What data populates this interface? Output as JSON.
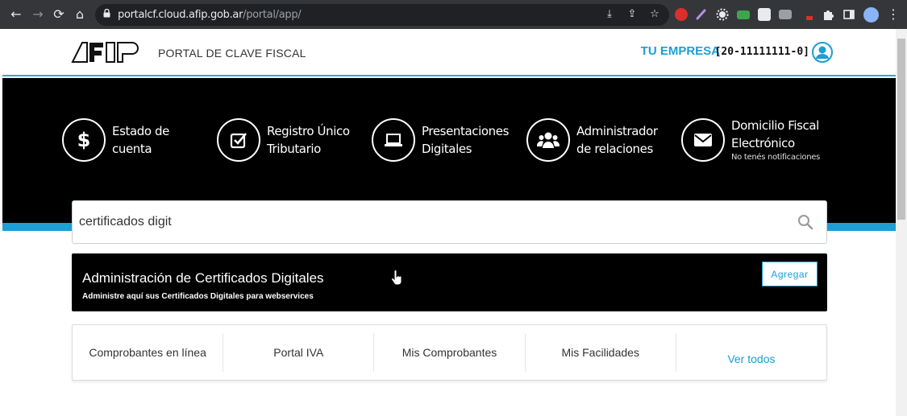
{
  "browser": {
    "url_host": "portalcf.cloud.afip.gob.ar",
    "url_path": "/portal/app/"
  },
  "header": {
    "logo_text": "AFIP",
    "portal_title": "PORTAL DE CLAVE FISCAL",
    "company_name": "TU EMPRESA",
    "cuit": "[20-11111111-0]"
  },
  "shortcuts": [
    {
      "line1": "Estado de",
      "line2": "cuenta",
      "icon": "dollar-icon"
    },
    {
      "line1": "Registro Único",
      "line2": "Tributario",
      "icon": "checkbox-icon"
    },
    {
      "line1": "Presentaciones",
      "line2": "Digitales",
      "icon": "laptop-icon"
    },
    {
      "line1": "Administrador",
      "line2": "de relaciones",
      "icon": "users-icon"
    },
    {
      "line1": "Domicilio Fiscal",
      "line2": "Electrónico",
      "sub": "No tenés notificaciones",
      "icon": "envelope-icon"
    }
  ],
  "search": {
    "value": "certificados digit"
  },
  "result": {
    "title": "Administración de Certificados Digitales",
    "description": "Administre aquí sus Certificados Digitales para webservices",
    "button_label": "Agregar"
  },
  "quick_links": [
    "Comprobantes en línea",
    "Portal IVA",
    "Mis Comprobantes",
    "Mis Facilidades",
    "Ver todos"
  ],
  "colors": {
    "accent": "#1a9fd6",
    "hero_bg": "#000000"
  }
}
